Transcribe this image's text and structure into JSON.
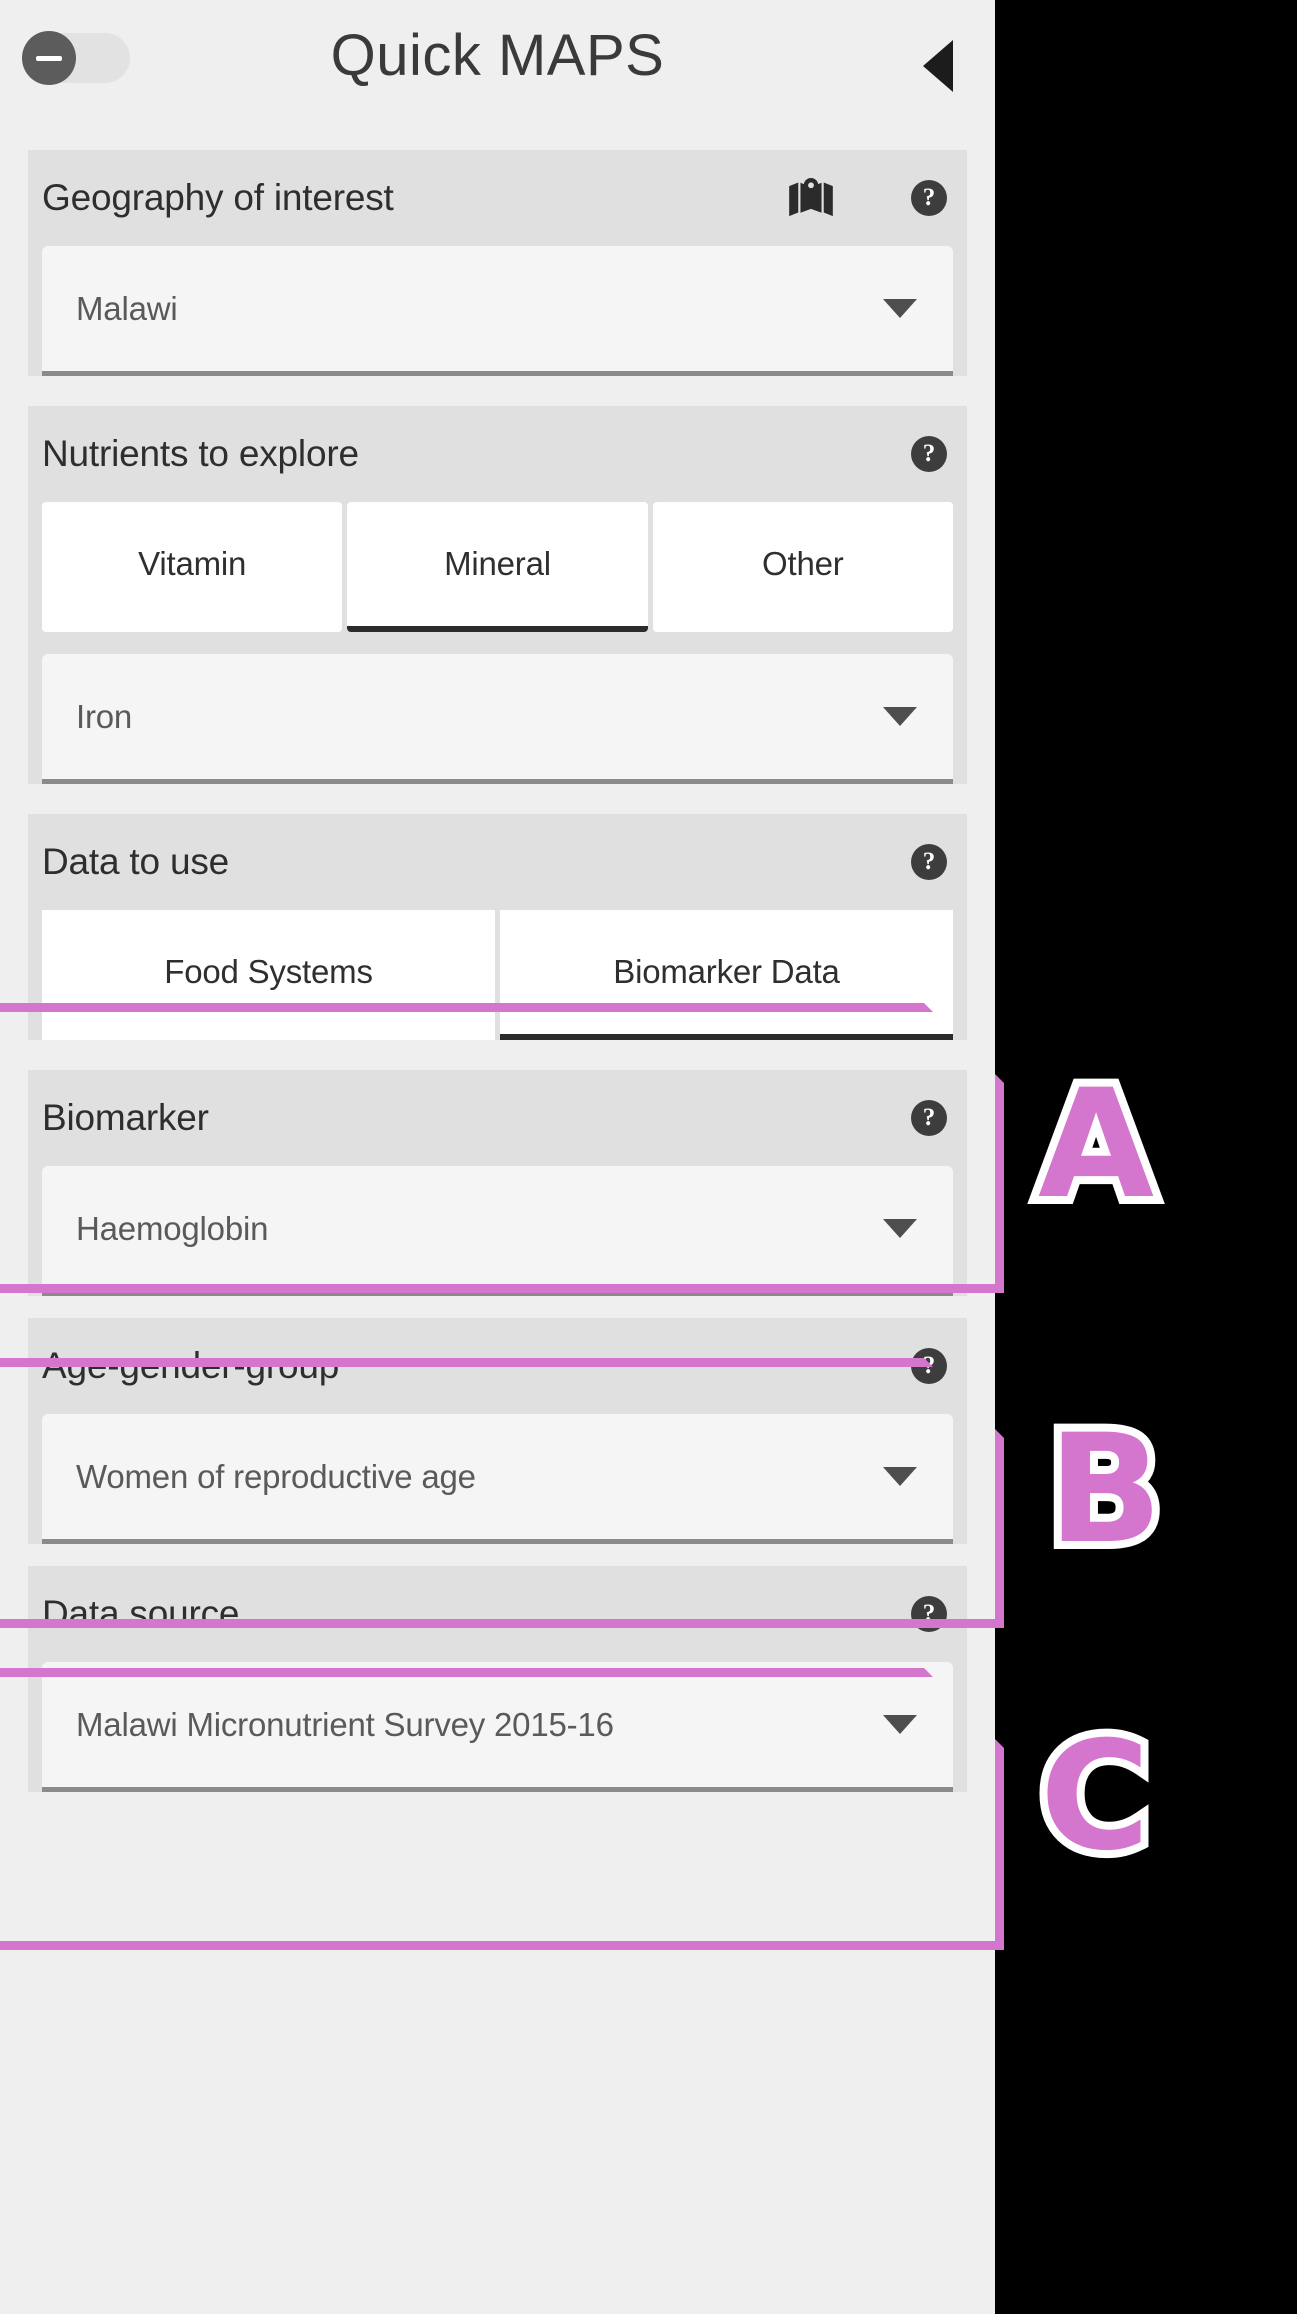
{
  "header": {
    "title": "Quick MAPS",
    "toggle_state": "off",
    "toggle_icon": "minus-icon",
    "collapse_icon": "left-triangle-icon"
  },
  "sections": [
    {
      "id": "geography",
      "title": "Geography of interest",
      "icons": [
        "map-icon",
        "help-icon"
      ],
      "help_label": "?",
      "control": "dropdown",
      "value": "Malawi"
    },
    {
      "id": "nutrients",
      "title": "Nutrients to explore",
      "icons": [
        "help-icon"
      ],
      "help_label": "?",
      "control": "tabs-and-dropdown",
      "tabs": [
        {
          "label": "Vitamin",
          "selected": false
        },
        {
          "label": "Mineral",
          "selected": true
        },
        {
          "label": "Other",
          "selected": false
        }
      ],
      "value": "Iron"
    },
    {
      "id": "data-to-use",
      "title": "Data to use",
      "icons": [
        "help-icon"
      ],
      "help_label": "?",
      "control": "tabs",
      "tabs": [
        {
          "label": "Food Systems",
          "selected": false
        },
        {
          "label": "Biomarker Data",
          "selected": true
        }
      ]
    },
    {
      "id": "biomarker",
      "title": "Biomarker",
      "icons": [
        "help-icon"
      ],
      "help_label": "?",
      "control": "dropdown",
      "value": "Haemoglobin"
    },
    {
      "id": "age-gender-group",
      "title": "Age-gender-group",
      "icons": [
        "help-icon"
      ],
      "help_label": "?",
      "control": "dropdown",
      "value": "Women of reproductive age"
    },
    {
      "id": "data-source",
      "title": "Data source",
      "icons": [
        "help-icon"
      ],
      "help_label": "?",
      "control": "dropdown",
      "value": "Malawi Micronutrient Survey 2015-16"
    }
  ],
  "annotations": [
    {
      "label": "A",
      "target": "data-to-use"
    },
    {
      "label": "B",
      "target": "biomarker"
    },
    {
      "label": "C",
      "target": "age-gender-group"
    }
  ],
  "colors": {
    "annotation_pink": "#d576ce",
    "annotation_outline": "#ffffff",
    "panel_bg": "#efefef",
    "section_bg": "#e0e0e0",
    "field_bg": "#f5f5f5",
    "backdrop": "#000000"
  }
}
